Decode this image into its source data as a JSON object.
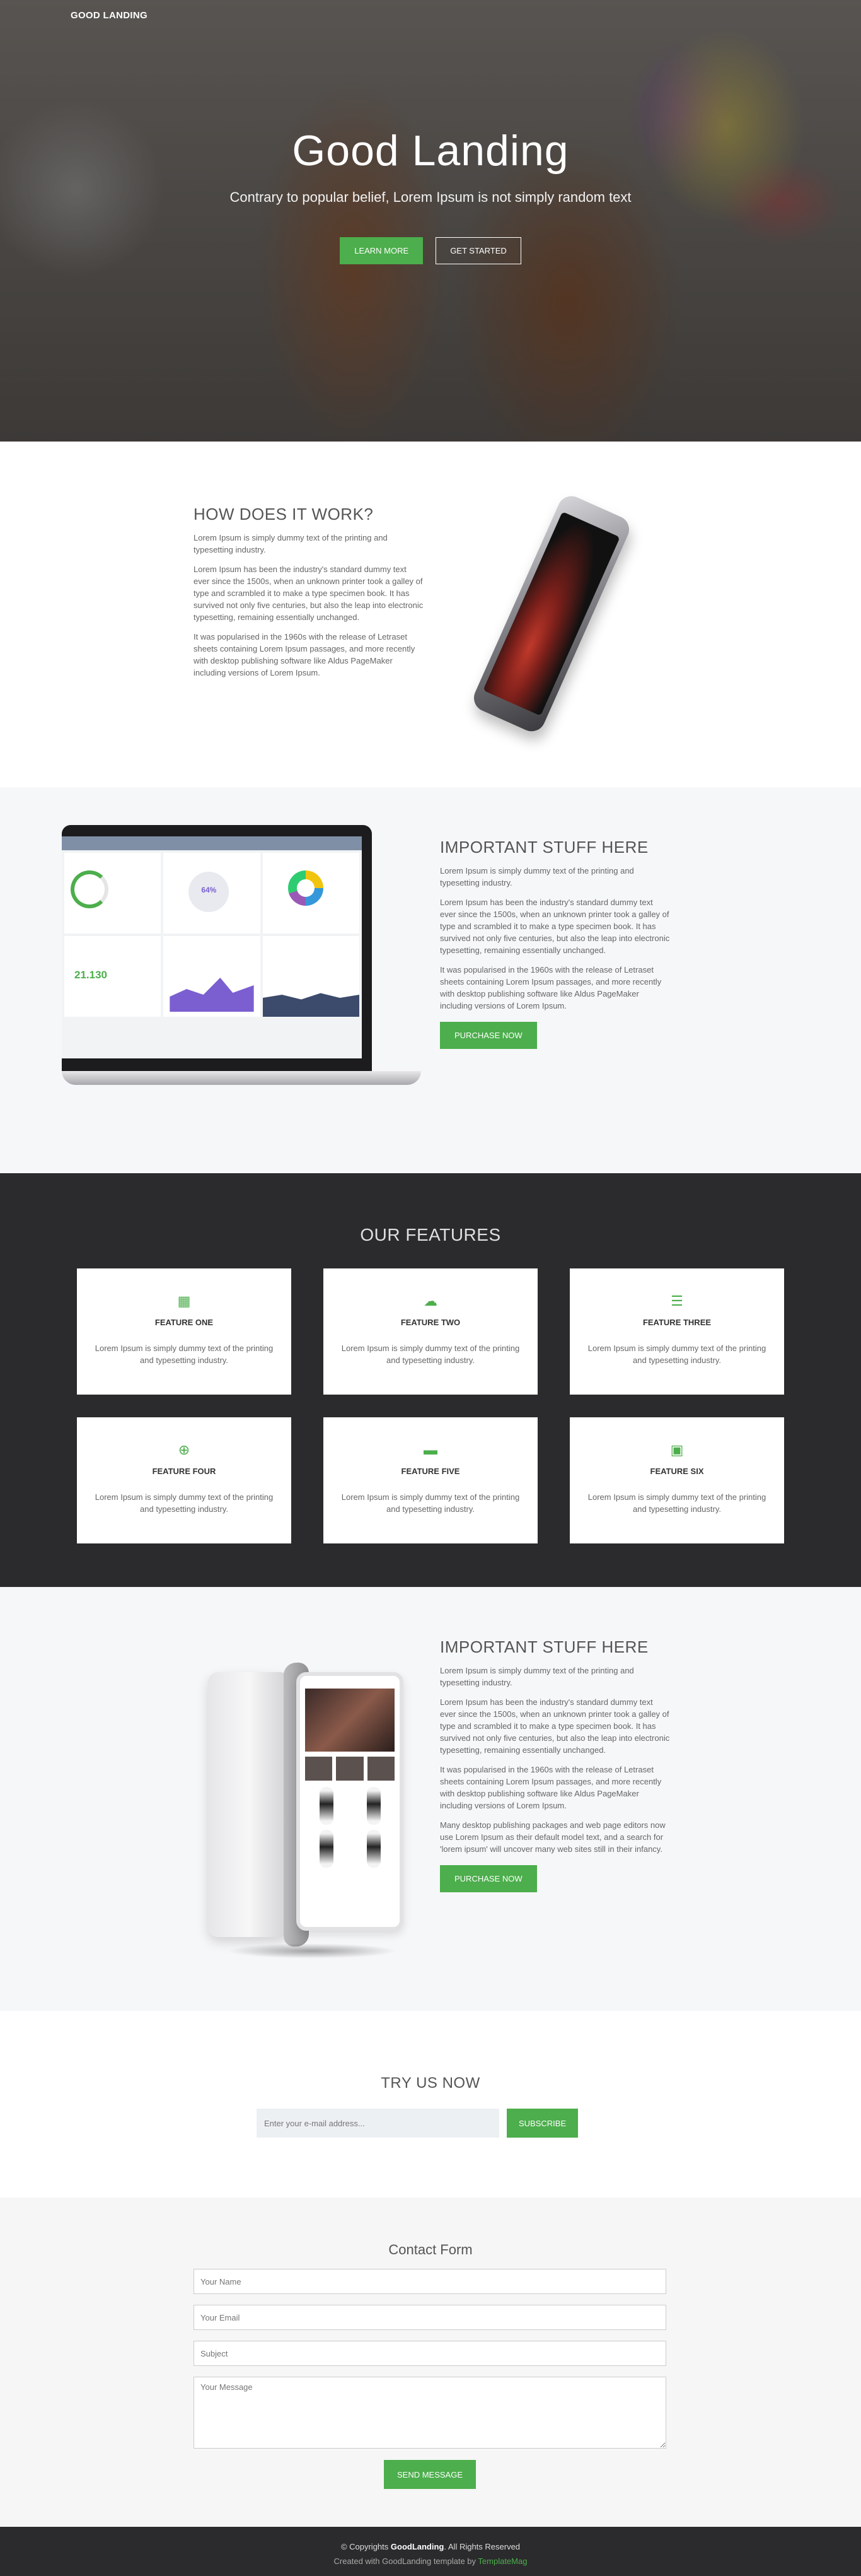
{
  "brand": "GOOD LANDING",
  "hero": {
    "title": "Good Landing",
    "subtitle": "Contrary to popular belief, Lorem Ipsum is not simply random text",
    "learn_more": "LEARN MORE",
    "get_started": "GET STARTED"
  },
  "how": {
    "title": "HOW DOES IT WORK?",
    "p1": "Lorem Ipsum is simply dummy text of the printing and typesetting industry.",
    "p2": "Lorem Ipsum has been the industry's standard dummy text ever since the 1500s, when an unknown printer took a galley of type and scrambled it to make a type specimen book. It has survived not only five centuries, but also the leap into electronic typesetting, remaining essentially unchanged.",
    "p3": "It was popularised in the 1960s with the release of Letraset sheets containing Lorem Ipsum passages, and more recently with desktop publishing software like Aldus PageMaker including versions of Lorem Ipsum."
  },
  "important1": {
    "title": "IMPORTANT STUFF HERE",
    "p1": "Lorem Ipsum is simply dummy text of the printing and typesetting industry.",
    "p2": "Lorem Ipsum has been the industry's standard dummy text ever since the 1500s, when an unknown printer took a galley of type and scrambled it to make a type specimen book. It has survived not only five centuries, but also the leap into electronic typesetting, remaining essentially unchanged.",
    "p3": "It was popularised in the 1960s with the release of Letraset sheets containing Lorem Ipsum passages, and more recently with desktop publishing software like Aldus PageMaker including versions of Lorem Ipsum.",
    "button": "PURCHASE NOW",
    "laptop": {
      "percent": "64%",
      "big_number": "21.130"
    }
  },
  "features": {
    "title": "OUR FEATURES",
    "items": [
      {
        "title": "FEATURE ONE",
        "icon": "calendar-icon",
        "glyph": "▦",
        "text": "Lorem Ipsum is simply dummy text of the printing and typesetting industry."
      },
      {
        "title": "FEATURE TWO",
        "icon": "cloud-icon",
        "glyph": "☁",
        "text": "Lorem Ipsum is simply dummy text of the printing and typesetting industry."
      },
      {
        "title": "FEATURE THREE",
        "icon": "list-icon",
        "glyph": "☰",
        "text": "Lorem Ipsum is simply dummy text of the printing and typesetting industry."
      },
      {
        "title": "FEATURE FOUR",
        "icon": "globe-icon",
        "glyph": "⊕",
        "text": "Lorem Ipsum is simply dummy text of the printing and typesetting industry."
      },
      {
        "title": "FEATURE FIVE",
        "icon": "folder-icon",
        "glyph": "▬",
        "text": "Lorem Ipsum is simply dummy text of the printing and typesetting industry."
      },
      {
        "title": "FEATURE SIX",
        "icon": "briefcase-icon",
        "glyph": "▣",
        "text": "Lorem Ipsum is simply dummy text of the printing and typesetting industry."
      }
    ]
  },
  "important2": {
    "title": "IMPORTANT STUFF HERE",
    "p1": "Lorem Ipsum is simply dummy text of the printing and typesetting industry.",
    "p2": "Lorem Ipsum has been the industry's standard dummy text ever since the 1500s, when an unknown printer took a galley of type and scrambled it to make a type specimen book. It has survived not only five centuries, but also the leap into electronic typesetting, remaining essentially unchanged.",
    "p3": "It was popularised in the 1960s with the release of Letraset sheets containing Lorem Ipsum passages, and more recently with desktop publishing software like Aldus PageMaker including versions of Lorem Ipsum.",
    "p4": "Many desktop publishing packages and web page editors now use Lorem Ipsum as their default model text, and a search for 'lorem ipsum' will uncover many web sites still in their infancy.",
    "button": "PURCHASE NOW"
  },
  "try_us": {
    "title": "TRY US NOW",
    "placeholder": "Enter your e-mail address...",
    "button": "SUBSCRIBE"
  },
  "contact": {
    "title": "Contact Form",
    "name_placeholder": "Your Name",
    "email_placeholder": "Your Email",
    "subject_placeholder": "Subject",
    "message_placeholder": "Your Message",
    "button": "SEND MESSAGE"
  },
  "footer": {
    "copyright_prefix": "© Copyrights ",
    "brand": "GoodLanding",
    "copyright_suffix": ". All Rights Reserved",
    "created_prefix": "Created with GoodLanding template by ",
    "created_link": "TemplateMag"
  },
  "colors": {
    "accent": "#4cae4c",
    "dark": "#2b2b2d",
    "light_bg": "#f6f7f9"
  }
}
